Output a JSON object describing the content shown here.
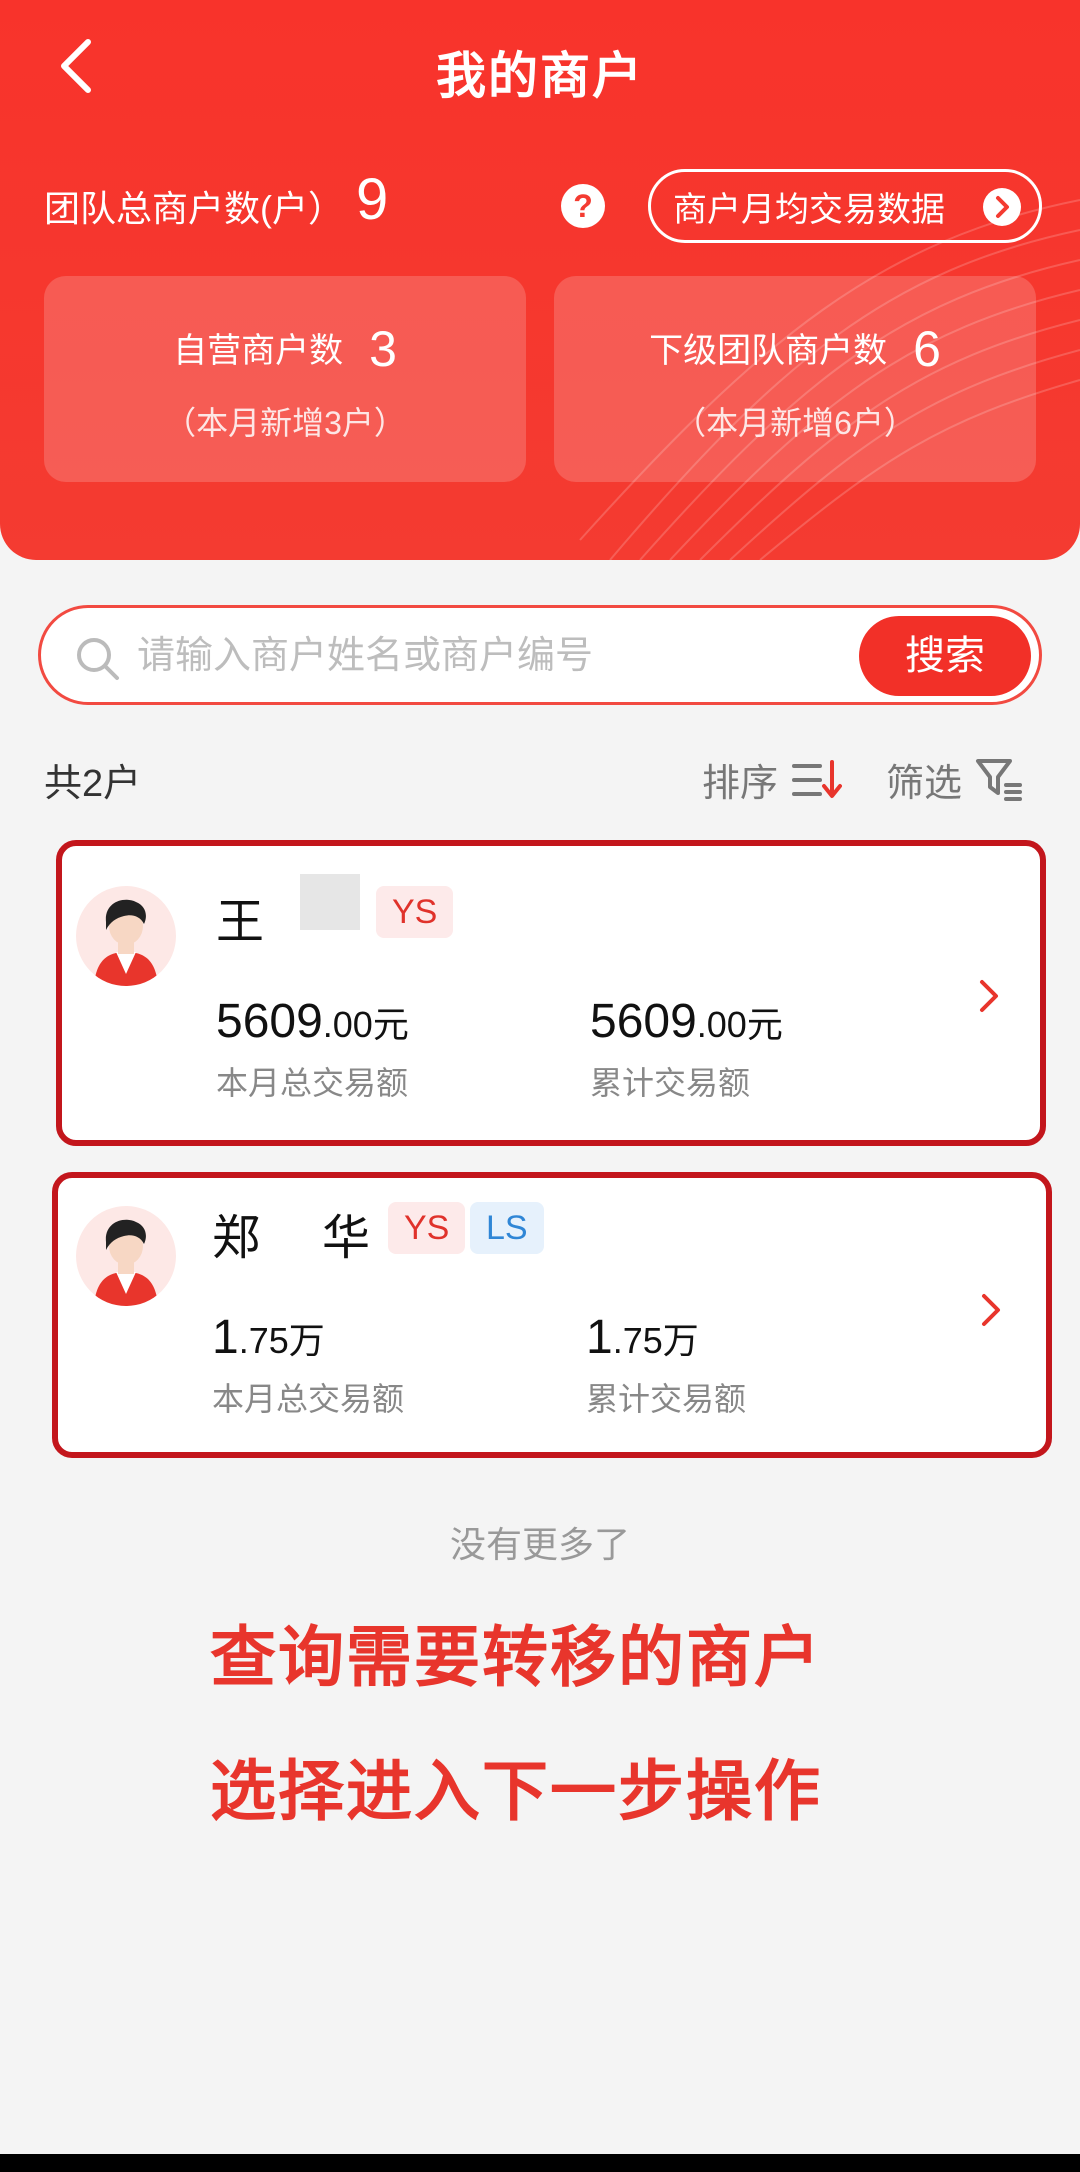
{
  "header": {
    "title": "我的商户",
    "team_label": "团队总商户数(户）",
    "team_count": "9",
    "help_icon": "?",
    "monthly_button_label": "商户月均交易数据"
  },
  "stats": [
    {
      "label": "自营商户数",
      "value": "3",
      "note": "（本月新增3户）"
    },
    {
      "label": "下级团队商户数",
      "value": "6",
      "note": "（本月新增6户）"
    }
  ],
  "search": {
    "placeholder": "请输入商户姓名或商户编号",
    "button_label": "搜索"
  },
  "list_header": {
    "total": "共2户",
    "sort_label": "排序",
    "filter_label": "筛选"
  },
  "merchants": [
    {
      "name": "王",
      "tags": [
        "YS"
      ],
      "month_amount_main": "5609",
      "month_amount_decimal": ".00元",
      "month_label": "本月总交易额",
      "total_amount_main": "5609",
      "total_amount_decimal": ".00元",
      "total_label": "累计交易额"
    },
    {
      "name": "郑",
      "name_tail": "华",
      "tags": [
        "YS",
        "LS"
      ],
      "month_amount_main": "1",
      "month_amount_decimal": ".75万",
      "month_label": "本月总交易额",
      "total_amount_main": "1",
      "total_amount_decimal": ".75万",
      "total_label": "累计交易额"
    }
  ],
  "footer": {
    "no_more": "没有更多了"
  },
  "annotations": {
    "line1": "查询需要转移的商户",
    "line2": "选择进入下一步操作"
  },
  "colors": {
    "brand_red": "#f43b31",
    "highlight_border": "#c3161c",
    "tag_ys": "#e0322b",
    "tag_ls": "#2f86d6"
  },
  "icons": [
    "back-arrow-icon",
    "help-icon",
    "chevron-right-circle-icon",
    "search-icon",
    "sort-icon",
    "filter-icon",
    "chevron-right-icon",
    "avatar-icon"
  ]
}
